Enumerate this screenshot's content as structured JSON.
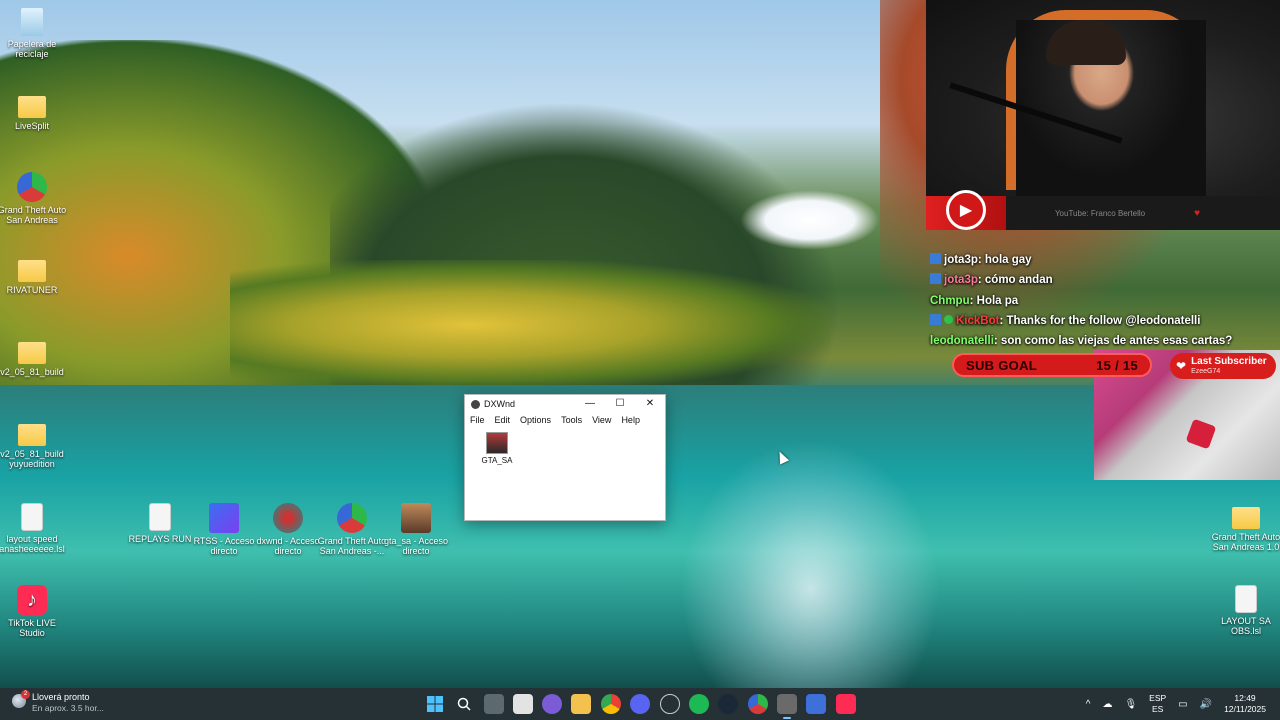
{
  "desktop_icons": [
    {
      "label": "Papelera de reciclaje",
      "icon": "recycle-bin-icon"
    },
    {
      "label": "LiveSplit",
      "icon": "folder-icon"
    },
    {
      "label": "Grand Theft Auto San Andreas",
      "icon": "gta-icon"
    },
    {
      "label": "RIVATUNER",
      "icon": "folder-icon"
    },
    {
      "label": "v2_05_81_build",
      "icon": "folder-icon"
    },
    {
      "label": "v2_05_81_build yuyuedition",
      "icon": "folder-icon"
    },
    {
      "label": "layout speed anasheeeeee.lsl",
      "icon": "file-icon"
    },
    {
      "label": "REPLAYS RUN",
      "icon": "file-icon"
    },
    {
      "label": "RTSS - Acceso directo",
      "icon": "rtss-icon"
    },
    {
      "label": "dxwnd - Acceso directo",
      "icon": "dxwnd-icon"
    },
    {
      "label": "Grand Theft Auto San Andreas -...",
      "icon": "gta-icon"
    },
    {
      "label": "gta_sa - Acceso directo",
      "icon": "gta-sa-icon"
    },
    {
      "label": "TikTok LIVE Studio",
      "icon": "tiktok-icon"
    },
    {
      "label": "Grand Theft Auto San Andreas 1.0",
      "icon": "folder-icon"
    },
    {
      "label": "LAYOUT SA OBS.lsl",
      "icon": "file-icon"
    }
  ],
  "dxwnd": {
    "title": "DXWnd",
    "minimize": "—",
    "maximize": "☐",
    "close": "✕",
    "menu": [
      "File",
      "Edit",
      "Options",
      "Tools",
      "View",
      "Help"
    ],
    "entries": [
      {
        "label": "GTA_SA"
      }
    ]
  },
  "youtube_bar": {
    "text": "YouTube: Franco Bertello",
    "play": "▶",
    "heart": "♥"
  },
  "chat": [
    {
      "user": "jota3p",
      "text": ": hola gay",
      "user_color": "#ffffff",
      "badge": true,
      "verified": false
    },
    {
      "user": "jota3p",
      "text": ": cómo andan",
      "user_color": "#ff7a9a",
      "badge": true,
      "verified": false
    },
    {
      "user": "Chmpu",
      "text": ": Hola pa",
      "user_color": "#7fff6a",
      "badge": false,
      "verified": false
    },
    {
      "user": "KickBot",
      "text": ": Thanks for the follow @leodonatelli",
      "user_color": "#ff3a3a",
      "badge": true,
      "verified": true
    },
    {
      "user": "leodonatelli",
      "text": ": son como las viejas de antes esas cartas?",
      "user_color": "#7fff6a",
      "badge": false,
      "verified": false
    }
  ],
  "sub_goal": {
    "label": "SUB GOAL",
    "value": "15 / 15"
  },
  "last_subscriber": {
    "label": "Last Subscriber",
    "name": "EzeeG74",
    "heart": "❤"
  },
  "taskbar": {
    "weather_title": "Lloverá pronto",
    "weather_sub": "En aprox. 3.5 hor...",
    "weather_badge": "2",
    "lang_top": "ESP",
    "lang_bottom": "ES",
    "time": "12:49",
    "date": "12/11/2025",
    "tray_caret": "^"
  }
}
